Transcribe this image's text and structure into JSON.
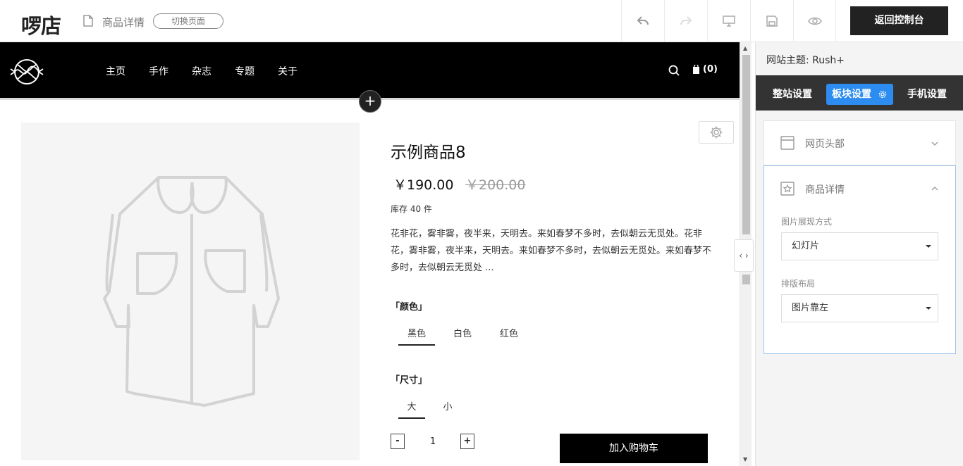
{
  "topbar": {
    "logo": "啰店",
    "page_name": "商品详情",
    "switch_label": "切换页面",
    "back_label": "返回控制台"
  },
  "site": {
    "menu": [
      "主页",
      "手作",
      "杂志",
      "专题",
      "关于"
    ],
    "cart_count": "(0)"
  },
  "product": {
    "title": "示例商品8",
    "price": "￥190.00",
    "old_price": "￥200.00",
    "stock": "库存 40 件",
    "description": "花非花，雾非雾，夜半来，天明去。来如春梦不多时，去似朝云无觅处。花非花，雾非雾，夜半来，天明去。来如春梦不多时，去似朝云无觅处。来如春梦不多时，去似朝云无觅处 ...",
    "color_label": "「颜色」",
    "colors": [
      "黑色",
      "白色",
      "红色"
    ],
    "size_label": "「尺寸」",
    "sizes": [
      "大",
      "小"
    ],
    "qty_minus": "-",
    "qty": "1",
    "qty_plus": "+",
    "add_to_cart": "加入购物车"
  },
  "panel": {
    "theme": "网站主题: Rush+",
    "tabs": [
      "整站设置",
      "板块设置",
      "手机设置"
    ],
    "section_header": "网页头部",
    "section_detail": "商品详情",
    "field_display_label": "图片展现方式",
    "field_display_value": "幻灯片",
    "field_layout_label": "排版布局",
    "field_layout_value": "图片靠左"
  },
  "colors": {
    "accent": "#2d8cf0",
    "dark": "#222222",
    "nav_bg": "#000000"
  }
}
